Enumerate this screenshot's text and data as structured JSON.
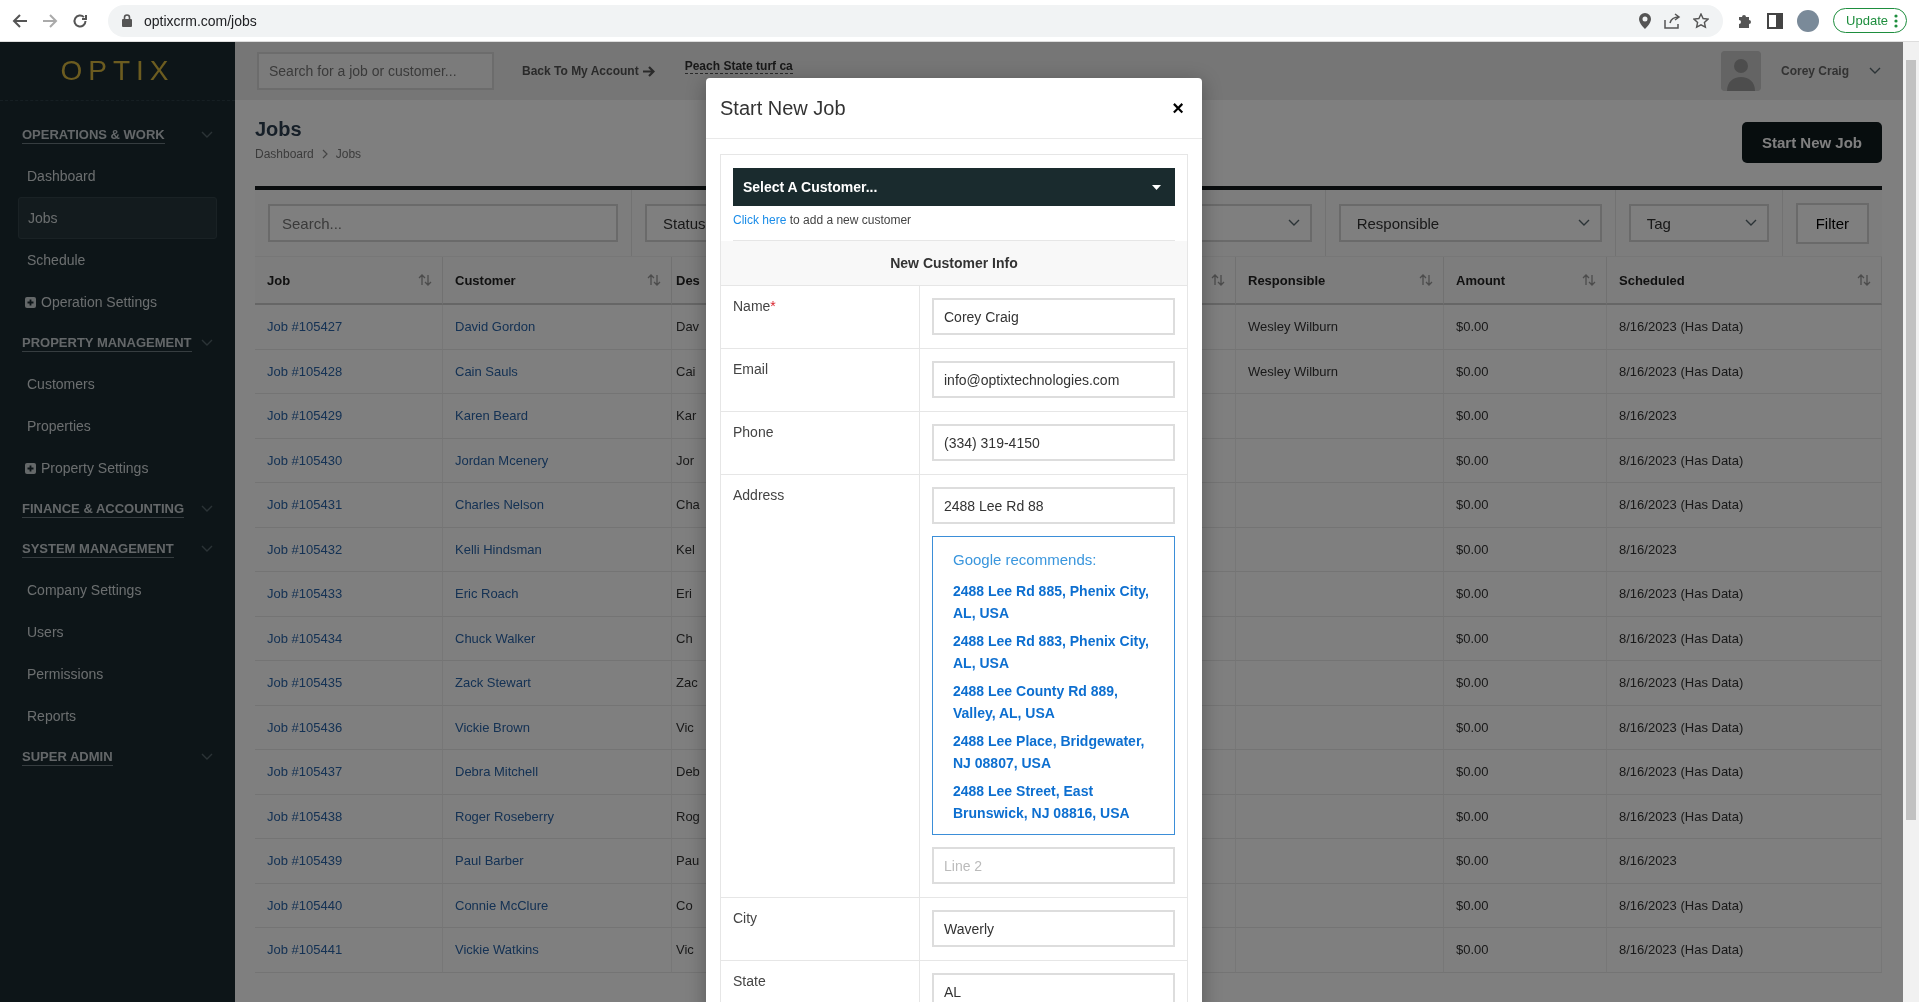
{
  "browser": {
    "url": "optixcrm.com/jobs",
    "update_label": "Update"
  },
  "sidebar": {
    "logo": "OPTIX",
    "sections": [
      {
        "title": "OPERATIONS & WORK",
        "items": [
          {
            "label": "Dashboard",
            "kind": "link",
            "selected": false
          },
          {
            "label": "Jobs",
            "kind": "link",
            "selected": true
          },
          {
            "label": "Schedule",
            "kind": "link",
            "selected": false
          },
          {
            "label": "Operation Settings",
            "kind": "expandable",
            "selected": false
          }
        ]
      },
      {
        "title": "PROPERTY MANAGEMENT",
        "items": [
          {
            "label": "Customers",
            "kind": "link",
            "selected": false
          },
          {
            "label": "Properties",
            "kind": "link",
            "selected": false
          },
          {
            "label": "Property Settings",
            "kind": "expandable",
            "selected": false
          }
        ]
      },
      {
        "title": "FINANCE & ACCOUNTING"
      },
      {
        "title": "SYSTEM MANAGEMENT",
        "items": [
          {
            "label": "Company Settings",
            "kind": "link",
            "selected": false
          },
          {
            "label": "Users",
            "kind": "link",
            "selected": false
          },
          {
            "label": "Permissions",
            "kind": "link",
            "selected": false
          },
          {
            "label": "Reports",
            "kind": "link",
            "selected": false
          }
        ]
      },
      {
        "title": "SUPER ADMIN"
      }
    ]
  },
  "header": {
    "search_placeholder": "Search for a job or customer...",
    "back_link": "Back To My Account",
    "account_link": "Peach State turf ca",
    "user_name": "Corey Craig"
  },
  "page": {
    "title": "Jobs",
    "breadcrumb": [
      "Dashboard",
      "Jobs"
    ],
    "start_button": "Start New Job"
  },
  "filters": {
    "search_placeholder": "Search...",
    "status": "Status",
    "responsible": "Responsible",
    "tag": "Tag",
    "filter_button": "Filter"
  },
  "table": {
    "columns": {
      "job": "Job",
      "customer": "Customer",
      "column_3": "Des",
      "responsible": "Responsible",
      "amount": "Amount",
      "scheduled": "Scheduled"
    },
    "rows": [
      {
        "job": "Job #105427",
        "customer": "David Gordon",
        "column_3": "Dav",
        "responsible": "Wesley Wilburn",
        "amount": "$0.00",
        "scheduled": "8/16/2023 (Has Data)"
      },
      {
        "job": "Job #105428",
        "customer": "Cain Sauls",
        "column_3": "Cai",
        "responsible": "Wesley Wilburn",
        "amount": "$0.00",
        "scheduled": "8/16/2023 (Has Data)"
      },
      {
        "job": "Job #105429",
        "customer": "Karen Beard",
        "column_3": "Kar",
        "amount": "$0.00",
        "scheduled": "8/16/2023"
      },
      {
        "job": "Job #105430",
        "customer": "Jordan Mcenery",
        "column_3": "Jor",
        "amount": "$0.00",
        "scheduled": "8/16/2023 (Has Data)"
      },
      {
        "job": "Job #105431",
        "customer": "Charles Nelson",
        "column_3": "Cha",
        "amount": "$0.00",
        "scheduled": "8/16/2023 (Has Data)"
      },
      {
        "job": "Job #105432",
        "customer": "Kelli Hindsman",
        "column_3": "Kel",
        "amount": "$0.00",
        "scheduled": "8/16/2023"
      },
      {
        "job": "Job #105433",
        "customer": "Eric Roach",
        "column_3": "Eri",
        "amount": "$0.00",
        "scheduled": "8/16/2023 (Has Data)"
      },
      {
        "job": "Job #105434",
        "customer": "Chuck Walker",
        "column_3": "Ch",
        "amount": "$0.00",
        "scheduled": "8/16/2023 (Has Data)"
      },
      {
        "job": "Job #105435",
        "customer": "Zack Stewart",
        "column_3": "Zac",
        "amount": "$0.00",
        "scheduled": "8/16/2023 (Has Data)"
      },
      {
        "job": "Job #105436",
        "customer": "Vickie Brown",
        "column_3": "Vic",
        "amount": "$0.00",
        "scheduled": "8/16/2023 (Has Data)"
      },
      {
        "job": "Job #105437",
        "customer": "Debra Mitchell",
        "column_3": "Deb",
        "amount": "$0.00",
        "scheduled": "8/16/2023 (Has Data)"
      },
      {
        "job": "Job #105438",
        "customer": "Roger Roseberry",
        "column_3": "Rog",
        "amount": "$0.00",
        "scheduled": "8/16/2023 (Has Data)"
      },
      {
        "job": "Job #105439",
        "customer": "Paul Barber",
        "column_3": "Pau",
        "amount": "$0.00",
        "scheduled": "8/16/2023"
      },
      {
        "job": "Job #105440",
        "customer": "Connie McClure",
        "column_3": "Co",
        "amount": "$0.00",
        "scheduled": "8/16/2023 (Has Data)"
      },
      {
        "job": "Job #105441",
        "customer": "Vickie Watkins",
        "column_3": "Vic",
        "amount": "$0.00",
        "scheduled": "8/16/2023 (Has Data)"
      }
    ]
  },
  "modal": {
    "title": "Start New Job",
    "close": "×",
    "customer_select": "Select A Customer...",
    "add_link": "Click here",
    "add_text": "to add a new customer",
    "section_title": "New Customer Info",
    "fields": [
      {
        "kind": "text",
        "label": "Name",
        "required_mark": "*",
        "value": "Corey Craig"
      },
      {
        "kind": "text",
        "label": "Email",
        "value": "info@optixtechnologies.com"
      },
      {
        "kind": "text",
        "label": "Phone",
        "value": "(334) 319-4150"
      },
      {
        "kind": "address",
        "label": "Address",
        "value": "2488 Lee Rd 88",
        "suggestions_title": "Google recommends:",
        "suggestions": [
          "2488 Lee Rd 885, Phenix City, AL, USA",
          "2488 Lee Rd 883, Phenix City, AL, USA",
          "2488 Lee County Rd 889, Valley, AL, USA",
          "2488 Lee Place, Bridgewater, NJ 08807, USA",
          "2488 Lee Street, East Brunswick, NJ 08816, USA"
        ],
        "line2_placeholder": "Line 2"
      },
      {
        "kind": "text",
        "label": "City",
        "value": "Waverly"
      },
      {
        "kind": "text",
        "label": "State",
        "value": "AL"
      }
    ]
  }
}
